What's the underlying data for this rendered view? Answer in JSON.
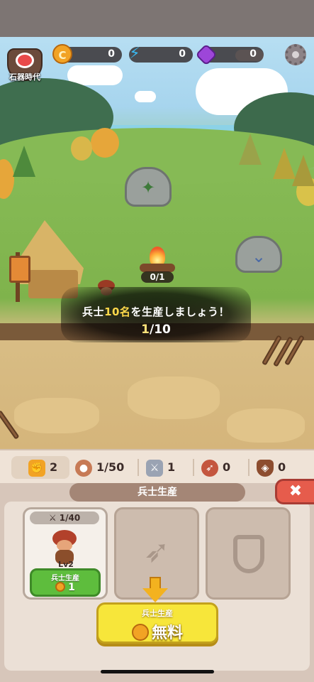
{
  "hud": {
    "era_label": "石器時代",
    "resources": [
      {
        "name": "coin",
        "icon": "coin-icon",
        "value": "0"
      },
      {
        "name": "energy",
        "icon": "lightning-icon",
        "value": "0"
      },
      {
        "name": "gem",
        "icon": "gem-icon",
        "value": "0"
      }
    ],
    "settings_icon": "gear-icon"
  },
  "scene": {
    "campfire_count": "0/1",
    "mission": {
      "text_before": "兵士",
      "text_highlight": "10名",
      "text_after": "を生産しましょう！",
      "progress_current": "1",
      "progress_total": "/10"
    }
  },
  "stats": {
    "level": "2",
    "population": "1/50",
    "swordsmen": "1",
    "archers": "0",
    "shields": "0"
  },
  "production": {
    "title": "兵士生産",
    "close_symbol": "✖",
    "unit": {
      "capacity": "1/40",
      "level": "Lv2",
      "buy_label": "兵士生産",
      "buy_cost": "1"
    },
    "bow_slot_icon": "bow-icon",
    "shield_slot_icon": "shield-icon",
    "free_button": {
      "label": "兵士生産",
      "text": "無料"
    }
  },
  "colors": {
    "accent_yellow": "#f7e63a",
    "buy_green": "#5ebd3d",
    "close_red": "#e65c4c"
  }
}
